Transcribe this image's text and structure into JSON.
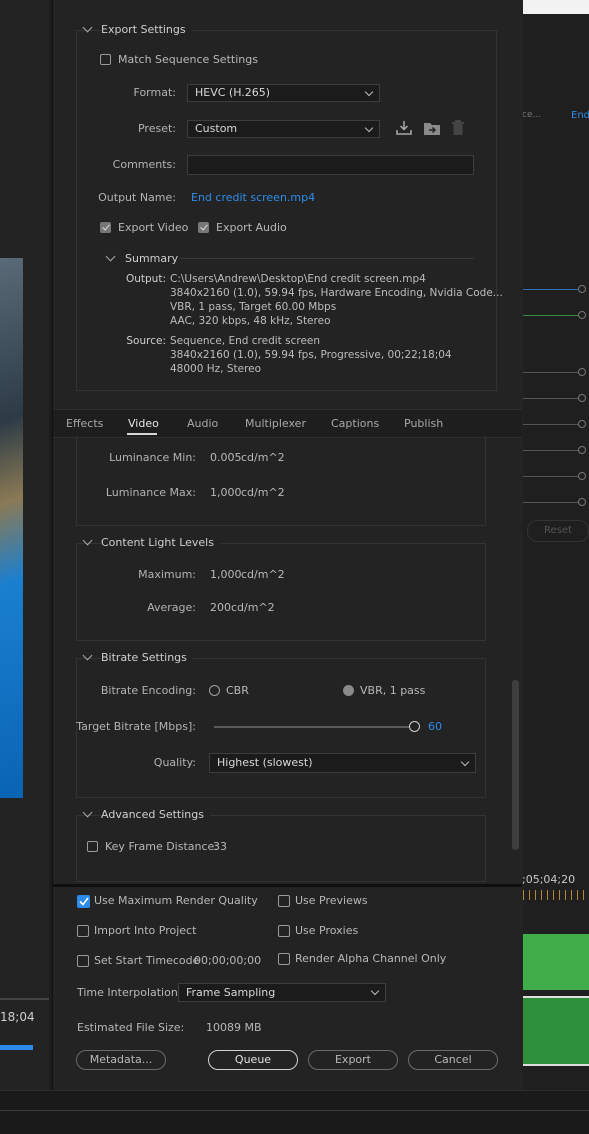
{
  "background": {
    "left_timecode": "18;04",
    "right_timecode": ";05;04;20",
    "right_tab_short": "ce...",
    "right_tab_label": "End",
    "reset_label": "Reset"
  },
  "export_settings": {
    "title": "Export Settings",
    "match_sequence": {
      "label": "Match Sequence Settings",
      "checked": false
    },
    "format": {
      "label": "Format:",
      "value": "HEVC (H.265)"
    },
    "preset": {
      "label": "Preset:",
      "value": "Custom"
    },
    "comments": {
      "label": "Comments:",
      "value": ""
    },
    "output_name": {
      "label": "Output Name:",
      "value": "End credit screen.mp4"
    },
    "export_video": {
      "label": "Export Video",
      "checked": true
    },
    "export_audio": {
      "label": "Export Audio",
      "checked": true
    },
    "summary": {
      "title": "Summary",
      "output_label": "Output:",
      "output_lines": [
        "C:\\Users\\Andrew\\Desktop\\End credit screen.mp4",
        "3840x2160 (1.0), 59.94 fps, Hardware Encoding, Nvidia Code...",
        "VBR, 1 pass, Target 60.00 Mbps",
        "AAC, 320 kbps, 48 kHz, Stereo"
      ],
      "source_label": "Source:",
      "source_lines": [
        "Sequence, End credit screen",
        "3840x2160 (1.0), 59.94 fps, Progressive, 00;22;18;04",
        "48000 Hz, Stereo"
      ]
    }
  },
  "tabs": [
    "Effects",
    "Video",
    "Audio",
    "Multiplexer",
    "Captions",
    "Publish"
  ],
  "active_tab": "Video",
  "luminance": {
    "min_label": "Luminance Min:",
    "min_value": "0.005",
    "min_unit": "cd/m^2",
    "max_label": "Luminance Max:",
    "max_value": "1,000",
    "max_unit": "cd/m^2"
  },
  "content_light": {
    "title": "Content Light Levels",
    "max_label": "Maximum:",
    "max_value": "1,000",
    "max_unit": "cd/m^2",
    "avg_label": "Average:",
    "avg_value": "200",
    "avg_unit": "cd/m^2"
  },
  "bitrate": {
    "title": "Bitrate Settings",
    "encoding_label": "Bitrate Encoding:",
    "option_cbr": "CBR",
    "option_vbr": "VBR, 1 pass",
    "selected": "VBR, 1 pass",
    "target_label": "Target Bitrate [Mbps]:",
    "target_value": "60",
    "target_fraction": 1.0,
    "quality_label": "Quality:",
    "quality_value": "Highest (slowest)"
  },
  "advanced": {
    "title": "Advanced Settings",
    "key_frame": {
      "label": "Key Frame Distance:",
      "value": "33",
      "checked": false
    }
  },
  "bottom": {
    "use_max_render": {
      "label": "Use Maximum Render Quality",
      "checked": true
    },
    "use_previews": {
      "label": "Use Previews",
      "checked": false
    },
    "import_project": {
      "label": "Import Into Project",
      "checked": false
    },
    "use_proxies": {
      "label": "Use Proxies",
      "checked": false
    },
    "set_start_tc": {
      "label": "Set Start Timecode",
      "value": "00;00;00;00",
      "checked": false
    },
    "render_alpha": {
      "label": "Render Alpha Channel Only",
      "checked": false
    },
    "time_interp": {
      "label": "Time Interpolation:",
      "value": "Frame Sampling"
    },
    "file_size": {
      "label": "Estimated File Size:",
      "value": "10089 MB"
    },
    "buttons": {
      "metadata": "Metadata...",
      "queue": "Queue",
      "export": "Export",
      "cancel": "Cancel"
    }
  },
  "colors": {
    "accent": "#2d8ceb",
    "panel": "#232323",
    "green": "#3fae4a"
  }
}
